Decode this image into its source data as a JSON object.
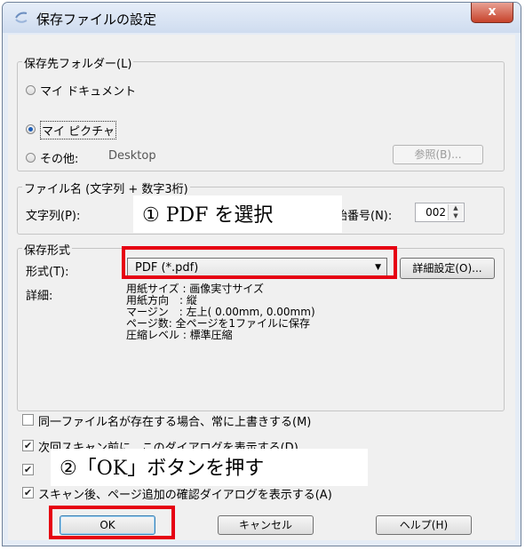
{
  "window": {
    "title": "保存ファイルの設定",
    "close_label": "x"
  },
  "folder_group": {
    "label": "保存先フォルダー(L)",
    "radio_my_documents": "マイ ドキュメント",
    "radio_my_pictures": "マイ ピクチャ",
    "radio_other": "その他:",
    "other_path": "Desktop",
    "browse_button": "参照(B)..."
  },
  "filename_group": {
    "label": "ファイル名 (文字列 + 数字3桁)",
    "prefix_label": "文字列(P):",
    "start_number_label": "開始番号(N):",
    "start_number_value": "002"
  },
  "format_group": {
    "label": "保存形式",
    "format_label": "形式(T):",
    "format_value": "PDF (*.pdf)",
    "detail_button": "詳細設定(O)...",
    "details_label": "詳細:",
    "details_lines": [
      "用紙サイズ : 画像実寸サイズ",
      "用紙方向　: 縦",
      "マージン　: 左上( 0.00mm, 0.00mm)",
      "ページ数: 全ページを1ファイルに保存",
      "圧縮レベル : 標準圧縮"
    ]
  },
  "options": {
    "overwrite": "同一ファイル名が存在する場合、常に上書きする(M)",
    "show_dialog": "次回スキャン前に、このダイアログを表示する(D)",
    "option3": "",
    "add_page_confirm": "スキャン後、ページ追加の確認ダイアログを表示する(A)"
  },
  "buttons": {
    "ok": "OK",
    "cancel": "キャンセル",
    "help": "ヘルプ(H)"
  },
  "annotations": {
    "step1": "① PDF を選択",
    "step2": "②「OK」ボタンを押す",
    "highlight_color": "#e60012"
  }
}
